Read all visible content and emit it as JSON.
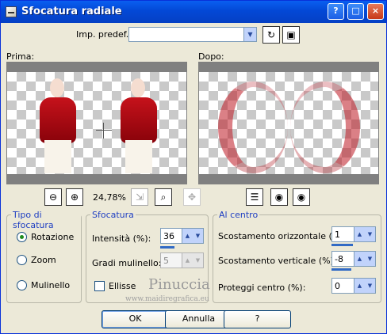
{
  "window": {
    "title": "Sfocatura radiale"
  },
  "presets": {
    "label": "Imp. predef.:",
    "value": ""
  },
  "preview": {
    "before_label": "Prima:",
    "after_label": "Dopo:",
    "zoom": "24,78%"
  },
  "blur_type": {
    "title": "Tipo di sfocatura",
    "options": [
      {
        "label": "Rotazione",
        "selected": true
      },
      {
        "label": "Zoom",
        "selected": false
      },
      {
        "label": "Mulinello",
        "selected": false
      }
    ]
  },
  "blur": {
    "title": "Sfocatura",
    "intensity_label": "Intensità (%):",
    "intensity_value": "36",
    "twirl_label": "Gradi mulinello:",
    "twirl_value": "5",
    "ellipse_label": "Ellisse",
    "ellipse_checked": false
  },
  "center": {
    "title": "Al centro",
    "horizontal_label": "Scostamento orizzontale (%):",
    "horizontal_value": "1",
    "vertical_label": "Scostamento verticale (%):",
    "vertical_value": "-8",
    "protect_label": "Proteggi centro (%):",
    "protect_value": "0"
  },
  "buttons": {
    "ok": "OK",
    "cancel": "Annulla",
    "help": "?"
  },
  "watermark": {
    "name": "Pinuccia",
    "site": "www.maidiregrafica.eu"
  },
  "colors": {
    "title_bar": "#0348d6",
    "accent": "#316ac5",
    "figure_red": "#c6121b"
  }
}
